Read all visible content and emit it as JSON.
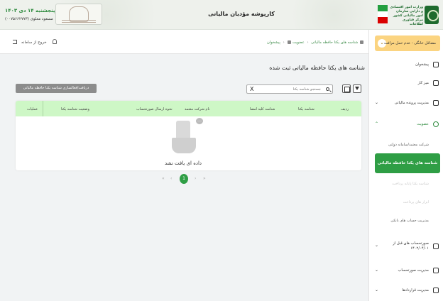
{
  "header": {
    "title": "کارپوشه مؤدیان مالیاتی",
    "date": "پنجشنبه ۱۴ دی ۱۴۰۳",
    "user": "مسعود معلوی (۰۰۷۵۶۶۲۷۷۳)",
    "logo_text": "وزارت امور اقتصادی و دارایی سازمان امور مالیاتی کشور مرکز فناوری اطلاعات"
  },
  "topbar": {
    "logout_label": "خروج از سامانه",
    "breadcrumb": [
      "پیشخوان",
      "عضویت",
      "شناسه های یکتا حافظه مالیاتی"
    ]
  },
  "main": {
    "page_title": "شناسه های یکتا حافظه مالیاتی ثبت شده",
    "receive_button": "دریافت/فعالسازی شناسه یکتا حافظه مالیاتی",
    "search": {
      "placeholder": "جستجو شناسه یکتا",
      "clear": "X"
    },
    "table": {
      "columns": [
        "ردیف",
        "شناسه یکتا",
        "شناسه کلید امضا",
        "نام شرکت معتمد",
        "نحوه ارسال صورتحساب",
        "وضعیت شناسه یکتا",
        "عملیات"
      ],
      "rows": [],
      "empty_text": "داده ای یافت نشد"
    },
    "pagination": {
      "current": "1"
    }
  },
  "sidebar": {
    "account": "مشاغل خانگی - عدم حمل مرافت",
    "items": [
      {
        "label": "پیشخوان",
        "icon": "home-icon"
      },
      {
        "label": "میز کار",
        "icon": "briefcase-icon"
      },
      {
        "label": "مدیریت پرونده مالیاتی",
        "icon": "file-icon"
      },
      {
        "label": "عضویت",
        "icon": "user-icon",
        "active": true
      }
    ],
    "sub_items": [
      {
        "label": "شرکت معتمد/سامانه دولتی",
        "state": "normal"
      },
      {
        "label": "شناسه های یکتا حافظه مالیاتی",
        "state": "active"
      },
      {
        "label": "شناسه یکتا پایانه پرداخت",
        "state": "disabled"
      },
      {
        "label": "ابزار های پرداخت",
        "state": "disabled"
      },
      {
        "label": "مدیریت حساب های بانکی",
        "state": "normal"
      }
    ],
    "bottom_items": [
      {
        "label": "صورتحساب های قبل از ۱۴۰۲/۰۴/۰۱",
        "icon": "invoice-icon"
      },
      {
        "label": "مدیریت صورتحساب",
        "icon": "receipt-icon"
      },
      {
        "label": "مدیریت قراردادها",
        "icon": "contract-icon"
      }
    ]
  },
  "colors": {
    "accent": "#2f9e45",
    "table_header": "#cef7c6",
    "account_bg": "#fbd481"
  }
}
